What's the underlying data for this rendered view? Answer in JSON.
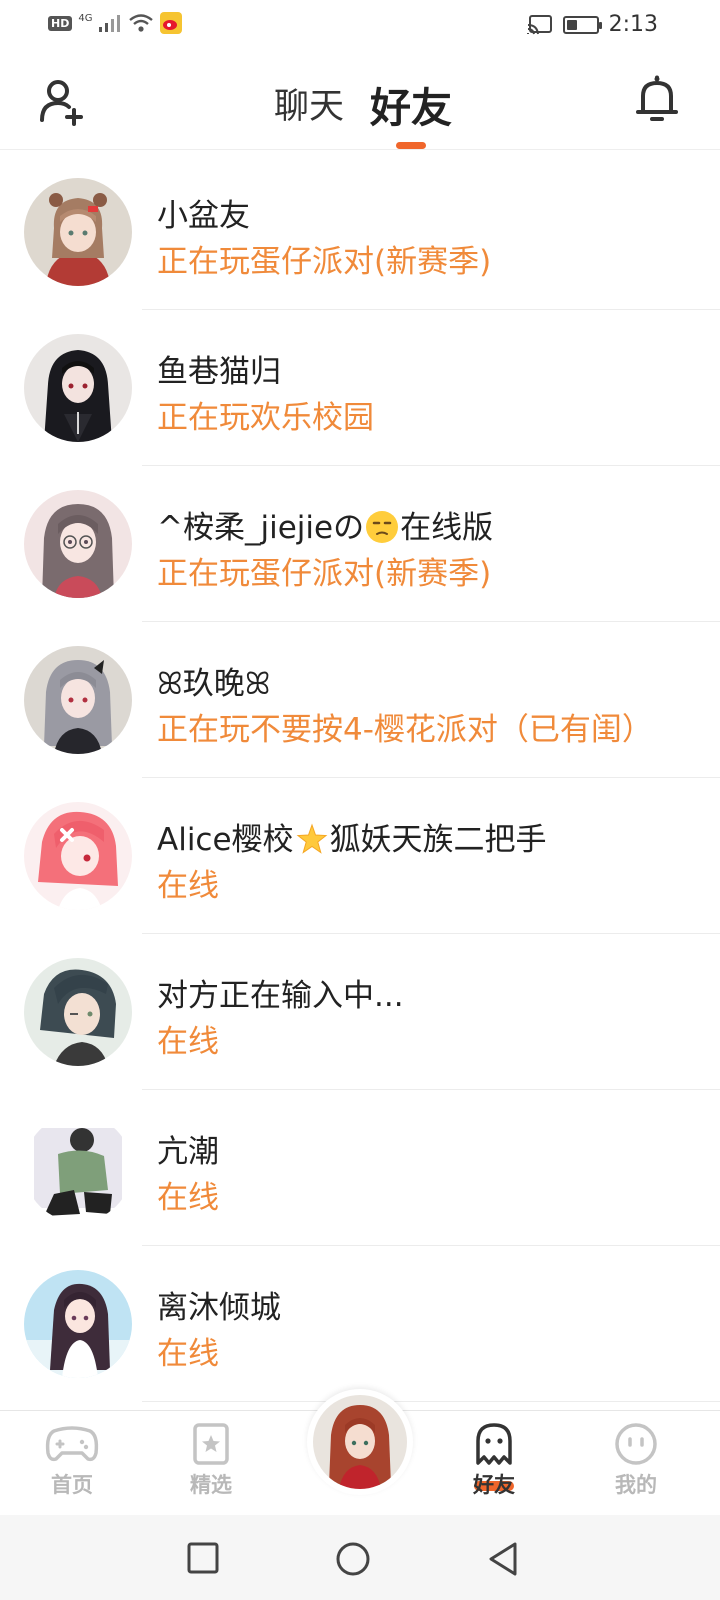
{
  "status_bar": {
    "hd": "HD",
    "network": "4G",
    "time": "2:13",
    "battery_level": 0.35
  },
  "header": {
    "tabs": [
      {
        "label": "聊天",
        "active": false
      },
      {
        "label": "好友",
        "active": true
      }
    ],
    "accent_color": "#f0662b"
  },
  "friends": [
    {
      "name": "小盆友",
      "status": "正在玩蛋仔派对(新赛季)",
      "avatar": "avatar-girl-brown-hair"
    },
    {
      "name": "鱼巷猫归",
      "status": "正在玩欢乐校园",
      "avatar": "avatar-girl-black-hair"
    },
    {
      "name_prefix": "^桉柔_jiejieの",
      "name_suffix": "在线版",
      "emoji": "unamused-face",
      "status": "正在玩蛋仔派对(新赛季)",
      "avatar": "avatar-girl-glasses"
    },
    {
      "name": "ꕤ玖晚ꕤ",
      "status": "正在玩不要按4-樱花派对（已有闺）",
      "avatar": "avatar-girl-grey-hair"
    },
    {
      "name_prefix": "Alice樱校",
      "name_suffix": "狐妖天族二把手",
      "emoji": "glowing-star",
      "status": "在线",
      "avatar": "avatar-girl-pink-hair"
    },
    {
      "name": "对方正在输入中...",
      "status": "在线",
      "avatar": "avatar-boy-dark-hair"
    },
    {
      "name": "亢潮",
      "status": "在线",
      "avatar": "avatar-figure-green"
    },
    {
      "name": "离沐倾城",
      "status": "在线",
      "avatar": "avatar-girl-beach"
    }
  ],
  "bottom_nav": [
    {
      "label": "首页",
      "icon": "gamepad-icon",
      "active": false
    },
    {
      "label": "精选",
      "icon": "star-card-icon",
      "active": false
    },
    {
      "label": "",
      "icon": "center-avatar",
      "active": false
    },
    {
      "label": "好友",
      "icon": "ghost-icon",
      "active": true
    },
    {
      "label": "我的",
      "icon": "smiley-icon",
      "active": false
    }
  ],
  "colors": {
    "status_text": "#f08a3a",
    "inactive_nav": "#b8b8b8"
  }
}
